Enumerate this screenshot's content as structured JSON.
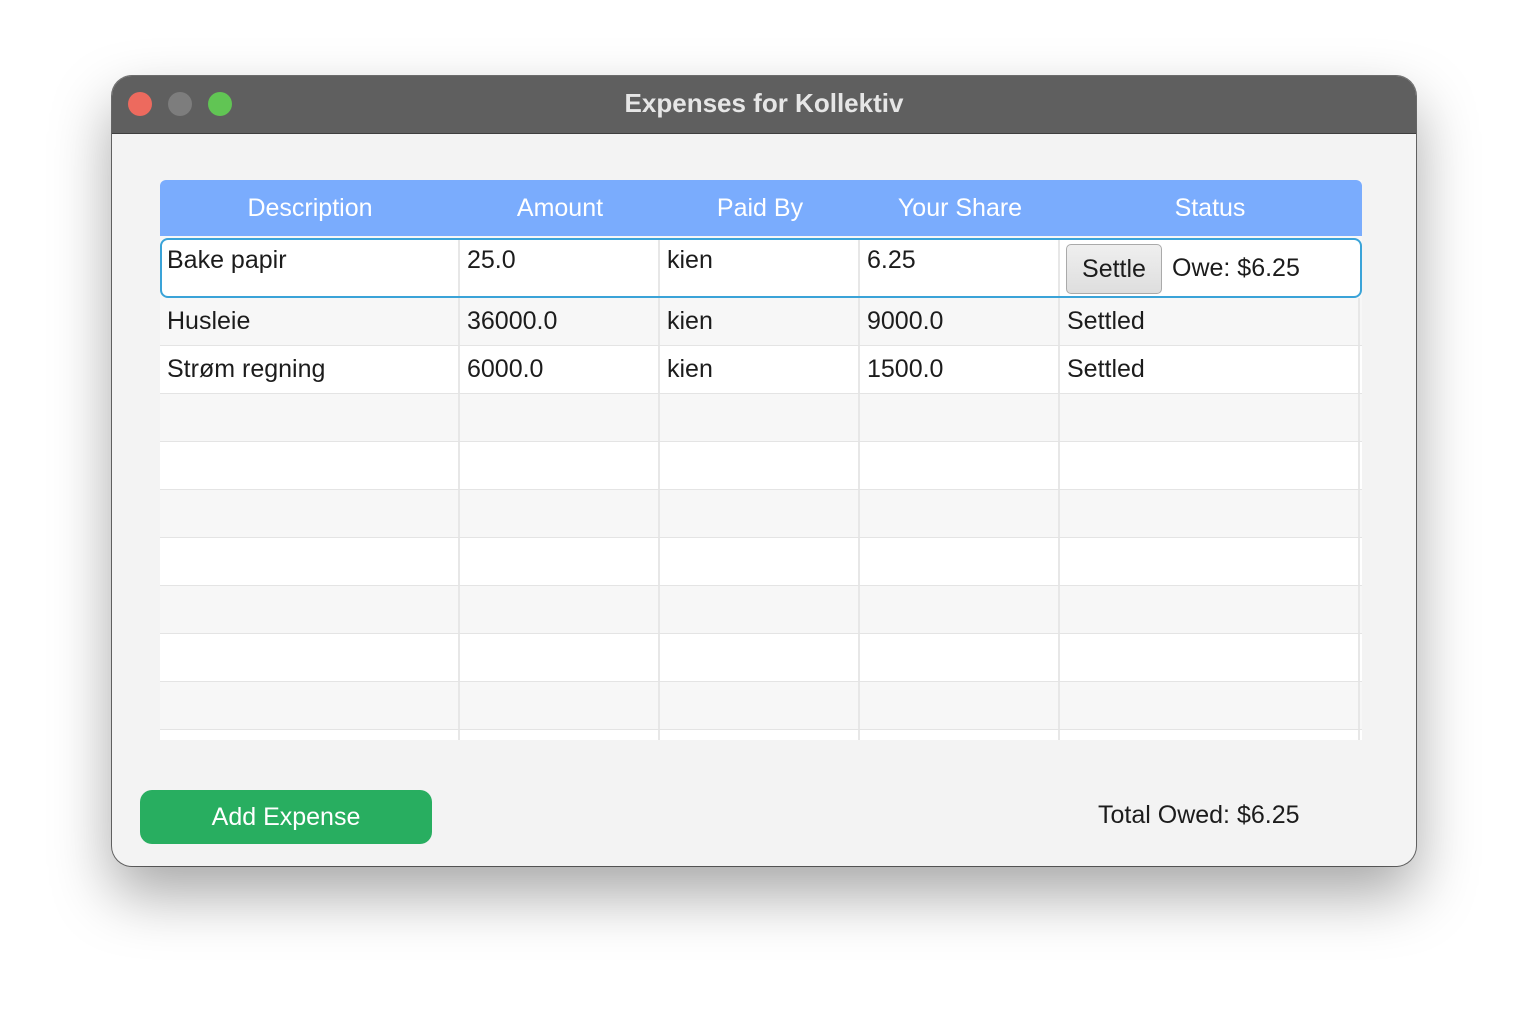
{
  "window": {
    "title": "Expenses for Kollektiv"
  },
  "table": {
    "columns": [
      "Description",
      "Amount",
      "Paid By",
      "Your Share",
      "Status"
    ],
    "rows": [
      {
        "description": "Bake papir",
        "amount": "25.0",
        "paid_by": "kien",
        "your_share": "6.25",
        "settle_label": "Settle",
        "status": "Owe: $6.25"
      },
      {
        "description": "Husleie",
        "amount": "36000.0",
        "paid_by": "kien",
        "your_share": "9000.0",
        "status": "Settled"
      },
      {
        "description": "Strøm regning",
        "amount": "6000.0",
        "paid_by": "kien",
        "your_share": "1500.0",
        "status": "Settled"
      }
    ]
  },
  "footer": {
    "add_button": "Add Expense",
    "total_owed": "Total Owed: $6.25"
  },
  "colors": {
    "header": "#7aacfd",
    "add_button": "#28ae60",
    "selection": "#3aa3d8"
  }
}
